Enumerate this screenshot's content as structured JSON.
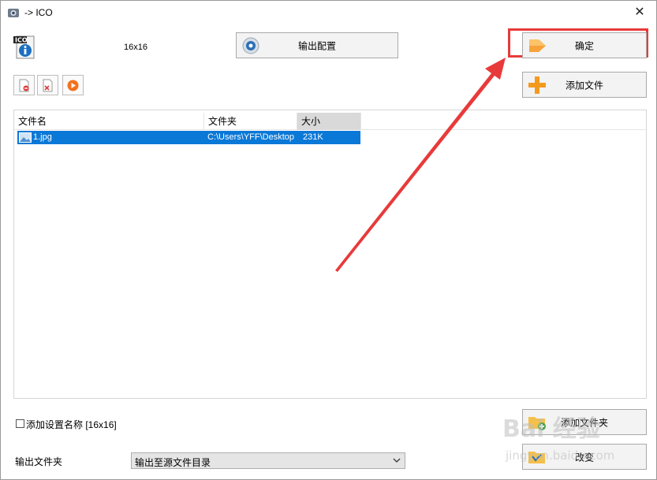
{
  "window": {
    "title": "-> ICO",
    "close_glyph": "✕"
  },
  "top": {
    "size_label": "16x16",
    "config_button": "输出配置",
    "ok_button": "确定",
    "add_file_button": "添加文件"
  },
  "list": {
    "columns": [
      "文件名",
      "文件夹",
      "大小"
    ],
    "rows": [
      {
        "name": "1.jpg",
        "folder": "C:\\Users\\YFF\\Desktop",
        "size": "231K"
      }
    ]
  },
  "bottom": {
    "checkbox_label": "添加设置名称 [16x16]",
    "output_folder_label": "输出文件夹",
    "output_folder_value": "输出至源文件目录",
    "add_folder_button": "添加文件夹",
    "change_button": "改变"
  },
  "watermark": {
    "logo_text": "Bai 经验",
    "url": "jingyan.baidu.com"
  },
  "colors": {
    "highlight": "#e83a3a",
    "selection": "#0a78d7",
    "annotation_arrow": "#e83a3a"
  },
  "icons": [
    "app-icon",
    "close-icon",
    "ico-file-icon",
    "config-gear-icon",
    "arrow-right-icon",
    "plus-icon",
    "remove-icon",
    "clear-icon",
    "play-icon",
    "image-file-icon",
    "folder-add-icon",
    "change-folder-icon",
    "chevron-down-icon"
  ]
}
